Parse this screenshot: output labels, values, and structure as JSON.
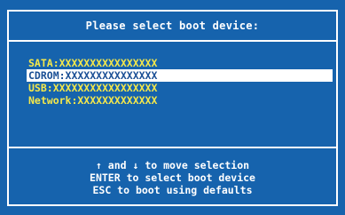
{
  "title": "Please select boot device:",
  "devices": [
    {
      "label": "SATA:XXXXXXXXXXXXXXXX",
      "selected": false
    },
    {
      "label": "CDROM:XXXXXXXXXXXXXXX",
      "selected": true
    },
    {
      "label": "USB:XXXXXXXXXXXXXXXXX",
      "selected": false
    },
    {
      "label": "Network:XXXXXXXXXXXXX",
      "selected": false
    }
  ],
  "help": {
    "up_arrow": "↑",
    "and_text": " and ",
    "down_arrow": "↓",
    "move_text": " to move selection",
    "line2": "ENTER to select boot device",
    "line3": "ESC to boot using defaults"
  },
  "colors": {
    "background": "#1663ad",
    "item_text": "#f5e84a",
    "selected_bg": "#ffffff",
    "selected_text": "#1a4f95"
  }
}
